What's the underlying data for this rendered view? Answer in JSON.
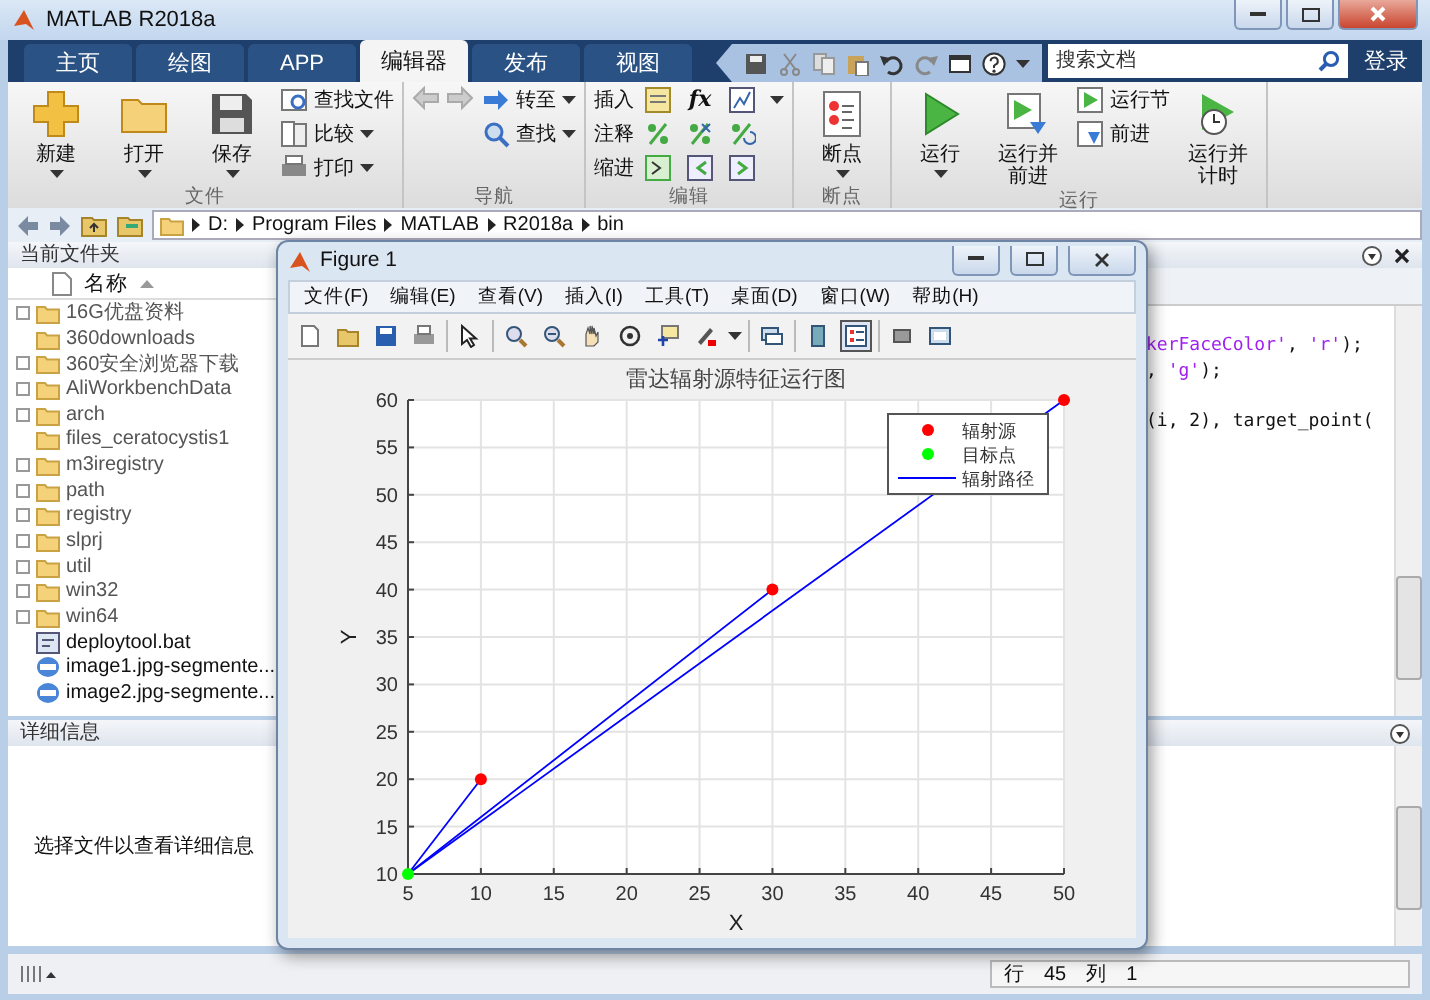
{
  "window": {
    "title": "MATLAB R2018a"
  },
  "tabs": [
    {
      "label": "主页",
      "selected": false
    },
    {
      "label": "绘图",
      "selected": false
    },
    {
      "label": "APP",
      "selected": false
    },
    {
      "label": "编辑器",
      "selected": true
    },
    {
      "label": "发布",
      "selected": false
    },
    {
      "label": "视图",
      "selected": false
    }
  ],
  "search": {
    "placeholder": "搜索文档"
  },
  "login": "登录",
  "ribbon": [
    {
      "label": "文件",
      "items": [
        {
          "kind": "large",
          "label": "新建",
          "menu": true
        },
        {
          "kind": "large",
          "label": "打开",
          "menu": true
        },
        {
          "kind": "large",
          "label": "保存",
          "menu": true
        },
        {
          "kind": "stack",
          "items": [
            {
              "label": "查找文件",
              "menu": false
            },
            {
              "label": "比较",
              "menu": true
            },
            {
              "label": "打印",
              "menu": true
            }
          ]
        }
      ]
    },
    {
      "label": "导航",
      "items": [
        {
          "kind": "nav"
        },
        {
          "kind": "stack",
          "items": [
            {
              "label": "转至",
              "menu": true
            },
            {
              "label": "查找",
              "menu": true
            }
          ]
        }
      ]
    },
    {
      "label": "编辑",
      "items": [
        {
          "kind": "stack",
          "items": [
            {
              "label": "插入",
              "menu": false
            },
            {
              "label": "注释",
              "menu": false
            },
            {
              "label": "缩进",
              "menu": false
            }
          ]
        },
        {
          "kind": "grid",
          "fx": "fx"
        }
      ]
    },
    {
      "label": "断点",
      "items": [
        {
          "kind": "large",
          "label": "断点",
          "menu": true
        }
      ]
    },
    {
      "label": "运行",
      "items": [
        {
          "kind": "large",
          "label": "运行",
          "menu": true
        },
        {
          "kind": "large",
          "label": "运行并前进",
          "menu": false
        },
        {
          "kind": "stack",
          "items": [
            {
              "label": "运行节",
              "menu": false
            },
            {
              "label": "前进",
              "menu": false
            }
          ]
        },
        {
          "kind": "large",
          "label": "运行并计时",
          "menu": false
        }
      ]
    }
  ],
  "address": [
    "D:",
    "Program Files",
    "MATLAB",
    "R2018a",
    "bin"
  ],
  "files_panel": {
    "title": "当前文件夹",
    "column": "名称",
    "files": [
      {
        "name": "16G优盘资料",
        "kind": "folder",
        "expandable": true
      },
      {
        "name": "360downloads",
        "kind": "folder",
        "expandable": false
      },
      {
        "name": "360安全浏览器下载",
        "kind": "folder",
        "expandable": true
      },
      {
        "name": "AliWorkbenchData",
        "kind": "folder",
        "expandable": true
      },
      {
        "name": "arch",
        "kind": "folder",
        "expandable": true
      },
      {
        "name": "files_ceratocystis1",
        "kind": "folder",
        "expandable": false
      },
      {
        "name": "m3iregistry",
        "kind": "folder",
        "expandable": true
      },
      {
        "name": "path",
        "kind": "folder",
        "expandable": true
      },
      {
        "name": "registry",
        "kind": "folder",
        "expandable": true
      },
      {
        "name": "slprj",
        "kind": "folder",
        "expandable": true
      },
      {
        "name": "util",
        "kind": "folder",
        "expandable": true
      },
      {
        "name": "win32",
        "kind": "folder",
        "expandable": true
      },
      {
        "name": "win64",
        "kind": "folder",
        "expandable": true
      },
      {
        "name": "deploytool.bat",
        "kind": "script",
        "expandable": false
      },
      {
        "name": "image1.jpg-segmente...",
        "kind": "image",
        "expandable": false
      },
      {
        "name": "image2.jpg-segmente...",
        "kind": "image",
        "expandable": false
      }
    ]
  },
  "details_panel": {
    "title": "详细信息",
    "message": "选择文件以查看详细信息"
  },
  "editor": {
    "lines": [
      {
        "gap_before": false,
        "segments": [
          {
            "text": "kerFaceColor'",
            "kind": "string"
          },
          {
            "text": ", ",
            "kind": "code"
          },
          {
            "text": "'r'",
            "kind": "string"
          },
          {
            "text": ");",
            "kind": "code"
          }
        ]
      },
      {
        "gap_before": false,
        "segments": [
          {
            "text": ", ",
            "kind": "code"
          },
          {
            "text": "'g'",
            "kind": "string"
          },
          {
            "text": ");",
            "kind": "code"
          }
        ]
      },
      {
        "gap_before": true,
        "segments": [
          {
            "text": "(i, 2), target_point(",
            "kind": "code"
          }
        ]
      }
    ]
  },
  "status_bar": {
    "row_label": "行",
    "row": "45",
    "col_label": "列",
    "col": "1"
  },
  "figure": {
    "title": "Figure 1",
    "menu": [
      "文件(F)",
      "编辑(E)",
      "查看(V)",
      "插入(I)",
      "工具(T)",
      "桌面(D)",
      "窗口(W)",
      "帮助(H)"
    ],
    "colorbar_toggle": {
      "selected": false
    },
    "legend_toggle": {
      "selected": true
    },
    "chart_data": {
      "type": "scatter",
      "title": "雷达辐射源特征运行图",
      "xlabel": "X",
      "ylabel": "Y",
      "xlim": [
        5,
        50
      ],
      "ylim": [
        10,
        60
      ],
      "xticks": [
        5,
        10,
        15,
        20,
        25,
        30,
        35,
        40,
        45,
        50
      ],
      "yticks": [
        10,
        15,
        20,
        25,
        30,
        35,
        40,
        45,
        50,
        55,
        60
      ],
      "grid": true,
      "legend": true,
      "series": [
        {
          "name": "辐射源",
          "color": "#ff0000",
          "marker": "circle",
          "x": [
            10,
            30,
            50
          ],
          "values": [
            20,
            40,
            60
          ]
        },
        {
          "name": "目标点",
          "color": "#00ff00",
          "marker": "circle",
          "x": [
            5
          ],
          "values": [
            10
          ]
        },
        {
          "name": "辐射路径",
          "type": "line",
          "color": "#0000ff",
          "marker": "none",
          "x": [
            5,
            10
          ],
          "values": [
            10,
            20
          ]
        },
        {
          "type": "line",
          "color": "#0000ff",
          "marker": "none",
          "x": [
            5,
            30
          ],
          "values": [
            10,
            40
          ]
        },
        {
          "type": "line",
          "color": "#0000ff",
          "marker": "none",
          "x": [
            5,
            50
          ],
          "values": [
            10,
            60
          ]
        }
      ]
    }
  }
}
